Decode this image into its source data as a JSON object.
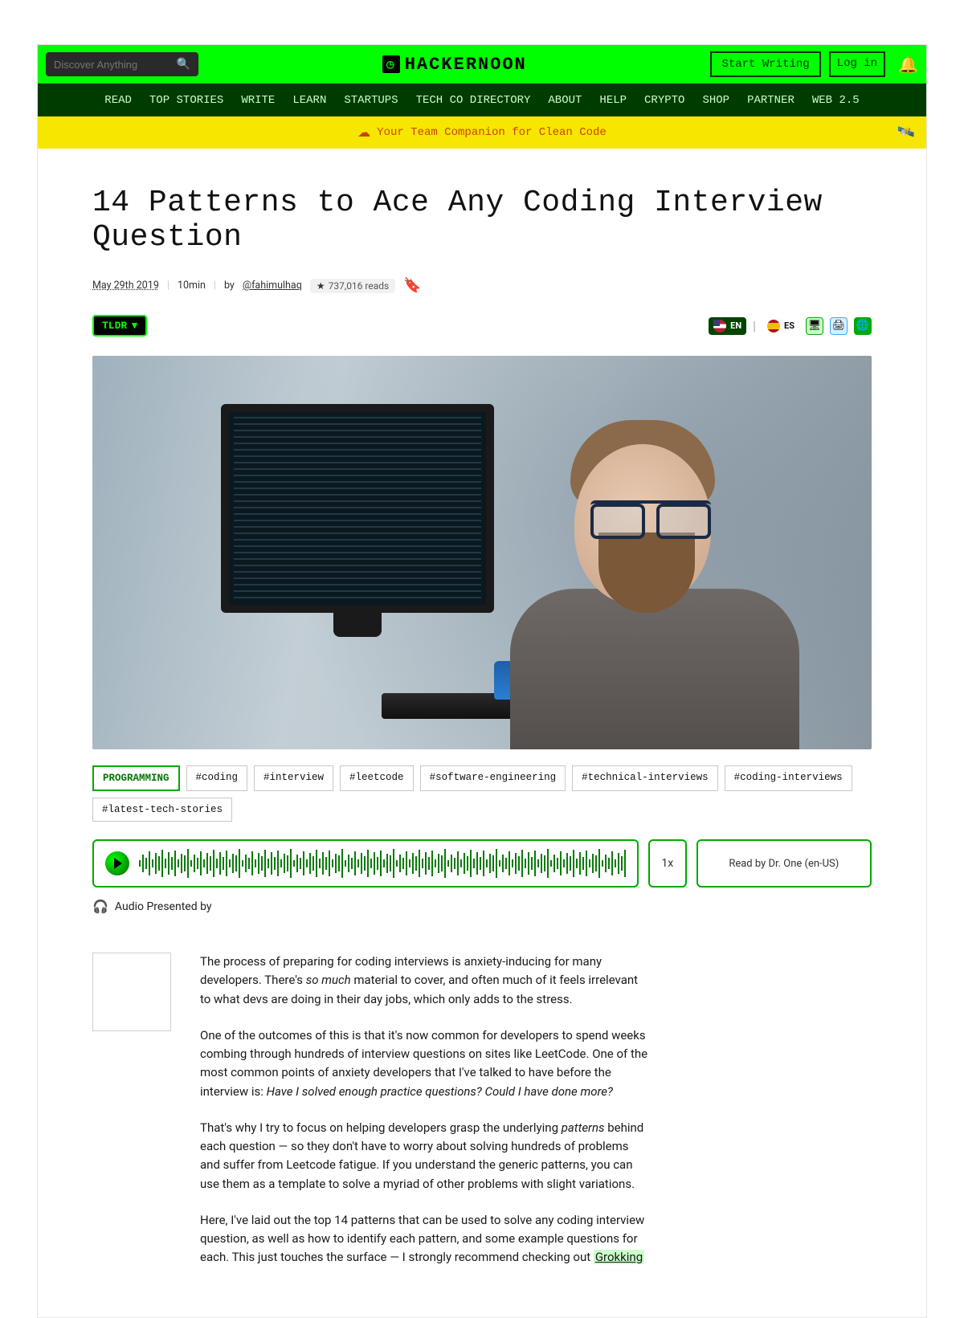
{
  "topbar": {
    "search_placeholder": "Discover Anything",
    "brand": "HACKERNOON",
    "start_writing": "Start Writing",
    "login": "Log in"
  },
  "nav": [
    "READ",
    "TOP STORIES",
    "WRITE",
    "LEARN",
    "STARTUPS",
    "TECH CO DIRECTORY",
    "ABOUT",
    "HELP",
    "CRYPTO",
    "SHOP",
    "PARTNER",
    "WEB 2.5"
  ],
  "promo": {
    "text": "Your Team Companion for Clean Code"
  },
  "article": {
    "title": "14 Patterns to Ace Any Coding Interview Question",
    "date": "May 29th 2019",
    "read_time": "10min",
    "by_label": "by",
    "author_handle": "@fahimulhaq",
    "reads": "737,016 reads",
    "tldr_label": "TLDR",
    "lang_en": "EN",
    "lang_es": "ES"
  },
  "tags": [
    "PROGRAMMING",
    "#coding",
    "#interview",
    "#leetcode",
    "#software-engineering",
    "#technical-interviews",
    "#coding-interviews",
    "#latest-tech-stories"
  ],
  "audio": {
    "speed": "1x",
    "voice": "Read by Dr. One (en-US)",
    "presented_label": "Audio Presented by"
  },
  "body": {
    "p1a": "The process of preparing for coding interviews is anxiety-inducing for many developers. There's ",
    "p1b": "so much",
    "p1c": " material to cover, and often much of it feels irrelevant to what devs are doing in their day jobs, which only adds to the stress.",
    "p2a": "One of the outcomes of this is that it's now common for developers to spend weeks combing through hundreds of interview questions on sites like LeetCode. One of the most common points of anxiety developers that I've talked to have before the interview is: ",
    "p2b": "Have I solved enough practice questions? Could I have done more?",
    "p3a": "That's why I try to focus on helping developers grasp the underlying ",
    "p3b": "patterns",
    "p3c": " behind each question — so they don't have to worry about solving hundreds of problems and suffer from Leetcode fatigue. If you understand the generic patterns, you can use them as a template to solve a myriad of other problems with slight variations.",
    "p4a": "Here, I've laid out the top 14 patterns that can be used to solve any coding interview question, as well as how to identify each pattern, and some example questions for each. This just touches the surface — I strongly recommend checking out ",
    "p4b": "Grokking"
  }
}
